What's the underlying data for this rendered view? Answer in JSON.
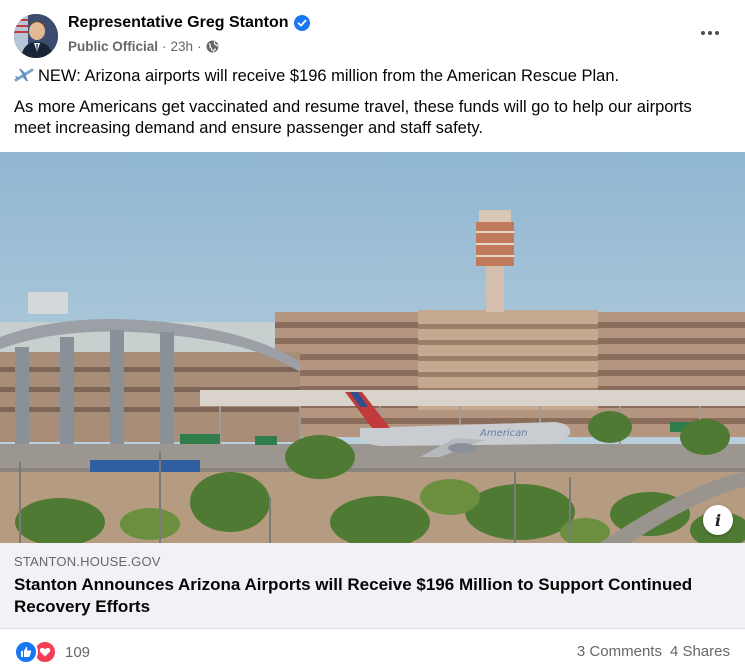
{
  "post": {
    "author": "Representative Greg Stanton",
    "role": "Public Official",
    "time": "23h",
    "separator": "·",
    "line1": "NEW: Arizona airports will receive $196 million from the American Rescue Plan.",
    "line2": "As more Americans get vaccinated and resume travel, these funds will go to help our airports meet increasing demand and ensure passenger and staff safety."
  },
  "link": {
    "domain": "STANTON.HOUSE.GOV",
    "title": "Stanton Announces Arizona Airports will Receive $196 Million to Support Continued Recovery Efforts"
  },
  "footer": {
    "reaction_count": "109",
    "comments": "3 Comments",
    "shares": "4 Shares"
  },
  "photo": {
    "aircraft_livery_text": "American"
  },
  "icons": {
    "verified": "verified-badge-icon",
    "globe": "globe-icon",
    "more": "more-options-icon",
    "plane": "airplane-emoji-icon",
    "info": "info-icon",
    "like": "like-reaction-icon",
    "love": "love-reaction-icon"
  },
  "colors": {
    "brand_blue": "#1877f2",
    "love_red": "#f33e58",
    "meta_gray": "#65676b",
    "link_card_bg": "#f0f2f5"
  }
}
